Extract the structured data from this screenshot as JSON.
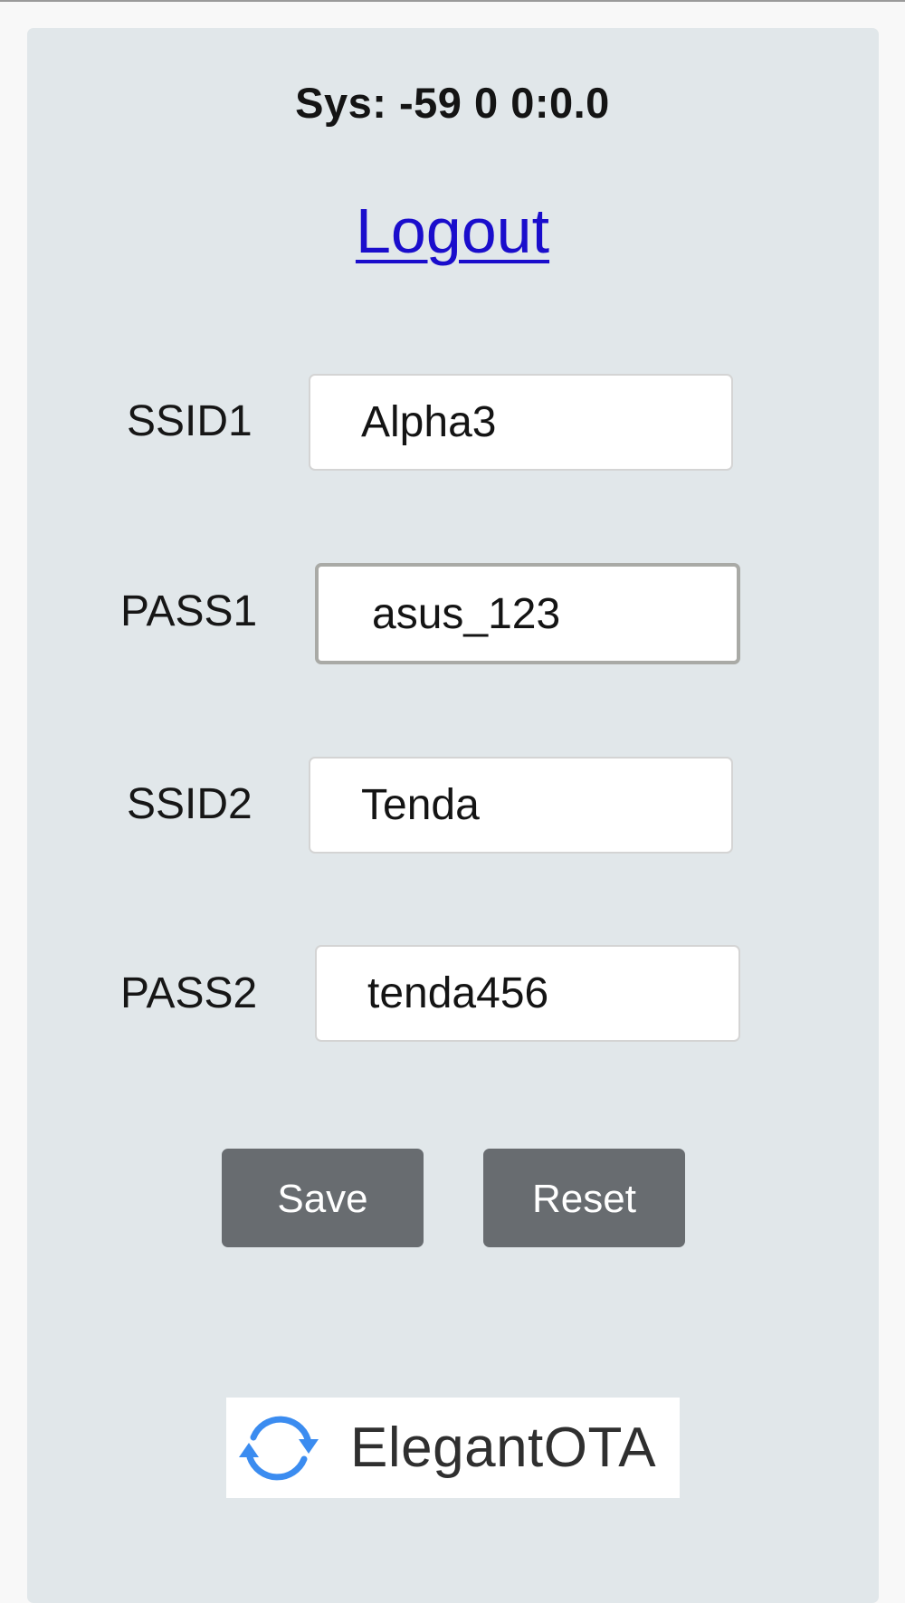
{
  "status": {
    "sys_text": "Sys: -59 0 0:0.0"
  },
  "header": {
    "logout_label": "Logout"
  },
  "form": {
    "ssid1": {
      "label": "SSID1",
      "value": "Alpha3"
    },
    "pass1": {
      "label": "PASS1",
      "value": "asus_123"
    },
    "ssid2": {
      "label": "SSID2",
      "value": "Tenda"
    },
    "pass2": {
      "label": "PASS2",
      "value": "tenda456"
    }
  },
  "actions": {
    "save_label": "Save",
    "reset_label": "Reset"
  },
  "footer": {
    "logo_text": "ElegantOTA",
    "logo_icon": "sync-arrows-icon"
  },
  "colors": {
    "panel_bg": "#e1e7ea",
    "button_bg": "#686c70",
    "link": "#1a0dcc",
    "logo_icon": "#3b8cf0"
  }
}
